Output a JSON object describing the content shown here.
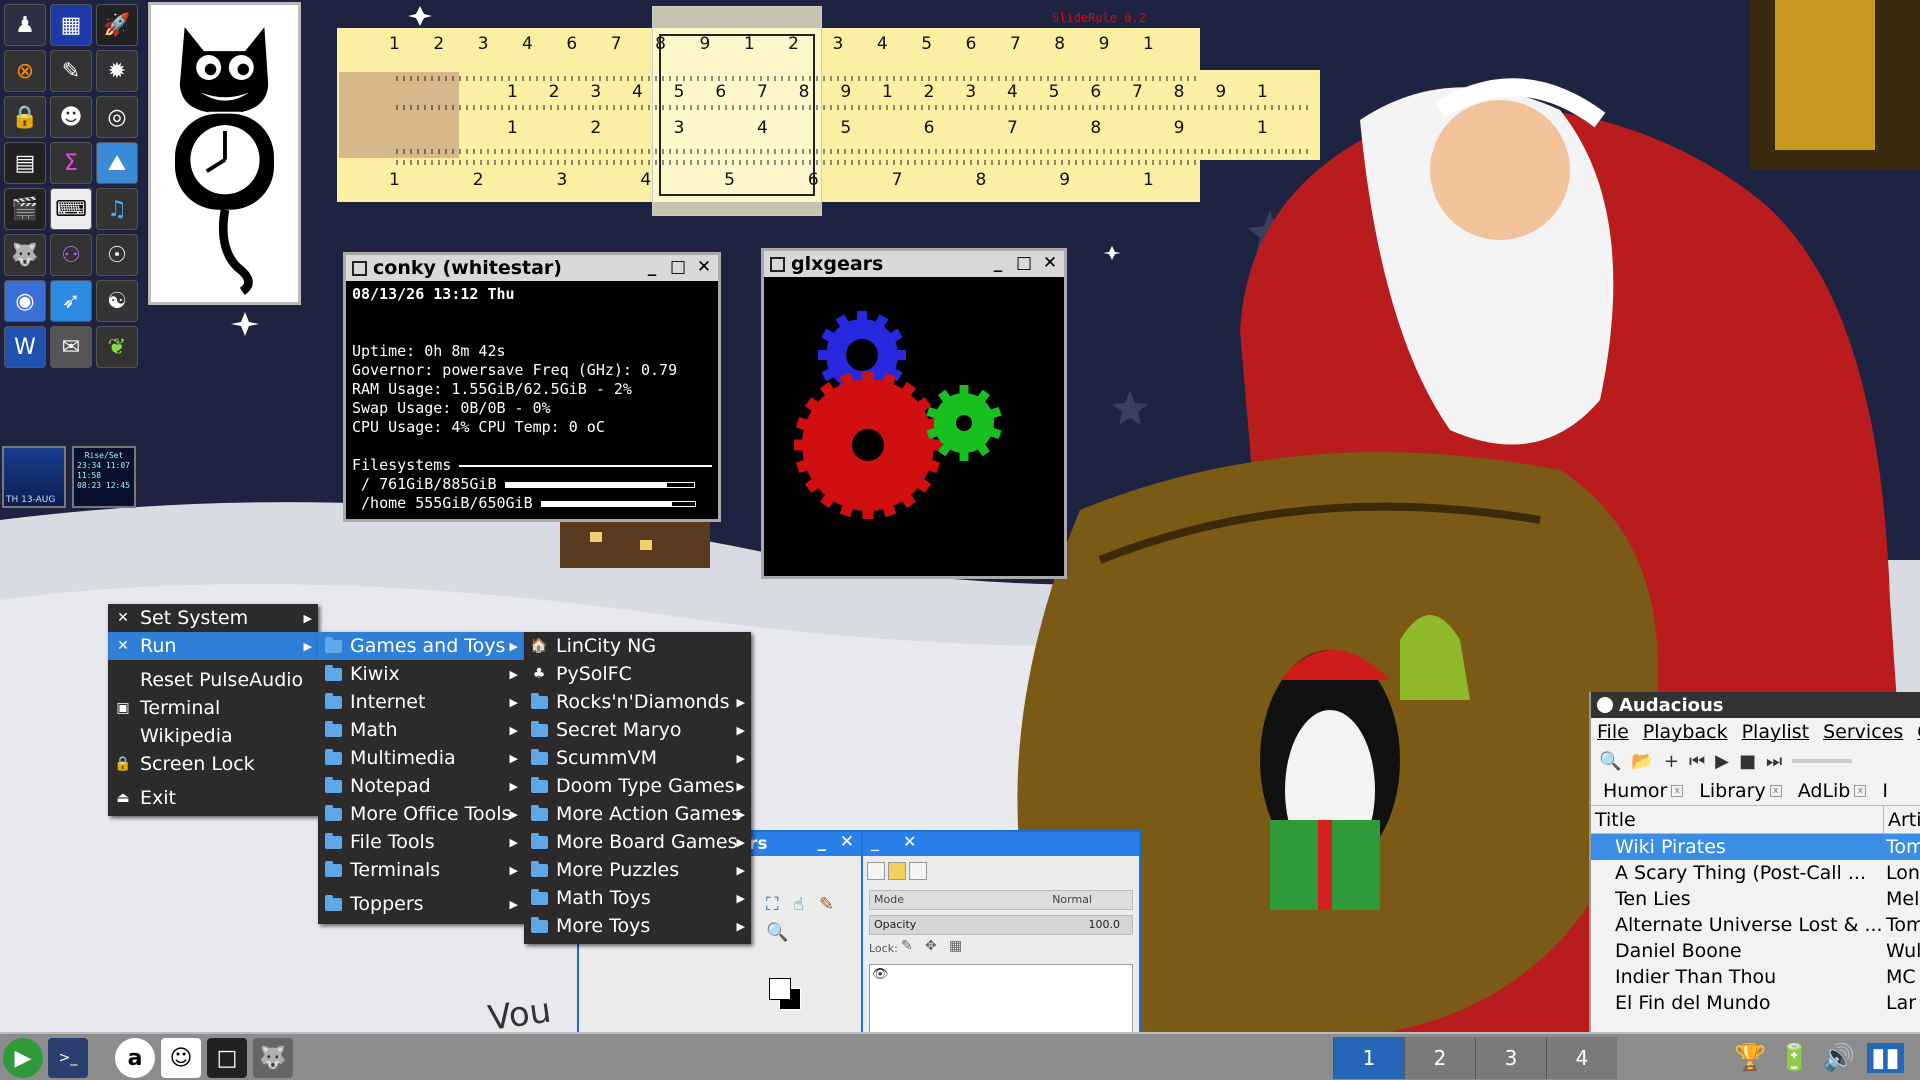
{
  "slide_rule": {
    "title": "SlideRule 0.2",
    "top_scale": [
      "1",
      "2",
      "3",
      "4",
      "6",
      "7",
      "8",
      "9",
      "1",
      "2",
      "3",
      "4",
      "5",
      "6",
      "7",
      "8",
      "9",
      "1"
    ],
    "slide_scale_1": [
      "1",
      "2",
      "3",
      "4",
      "5",
      "6",
      "7",
      "8",
      "9",
      "1",
      "2",
      "3",
      "4",
      "5",
      "6",
      "7",
      "8",
      "9",
      "1"
    ],
    "slide_scale_2": [
      "1",
      "2",
      "3",
      "4",
      "5",
      "6",
      "7",
      "8",
      "9",
      "1"
    ],
    "bottom_scale": [
      "1",
      "2",
      "3",
      "4",
      "5",
      "6",
      "7",
      "8",
      "9",
      "1"
    ]
  },
  "conky": {
    "title": "conky (whitestar)",
    "datetime": "08/13/26 13:12 Thu",
    "uptime": "Uptime: 0h 8m 42s",
    "governor": "Governor: powersave Freq (GHz): 0.79",
    "ram": "RAM Usage: 1.55GiB/62.5GiB - 2%",
    "swap": "Swap Usage: 0B/0B - 0%",
    "cpu": "CPU Usage: 4% CPU Temp: 0 oC",
    "fs_header": "Filesystems",
    "fs_root": " / 761GiB/885GiB",
    "fs_root_used": 0.86,
    "fs_home": " /home 555GiB/650GiB",
    "fs_home_used": 0.85
  },
  "glxgears": {
    "title": "glxgears"
  },
  "moon_widget": {
    "label": "TH 13-AUG"
  },
  "riseset_widget": {
    "title": "Rise/Set",
    "lines": [
      "23:34 11:07",
      "11:58",
      "08:23 12:45"
    ]
  },
  "gimp": {
    "toolbox_title_fragment": "rs",
    "mode_label": "Mode",
    "mode_value": "Normal",
    "opacity_label": "Opacity",
    "opacity_value": "100.0",
    "lock_label": "Lock:"
  },
  "menu_main": {
    "items": [
      {
        "label": "Set System",
        "icon": "tools-icon",
        "submenu": true
      },
      {
        "label": "Run",
        "icon": "tools-icon",
        "submenu": true,
        "selected": true
      },
      {
        "label": "Reset PulseAudio",
        "icon": ""
      },
      {
        "label": "Terminal",
        "icon": "terminal-icon"
      },
      {
        "label": "Wikipedia",
        "icon": ""
      },
      {
        "label": "Screen Lock",
        "icon": "lock-icon"
      },
      {
        "label": "Exit",
        "icon": "exit-icon"
      }
    ]
  },
  "menu_run": {
    "items": [
      {
        "label": "Games and Toys",
        "selected": true
      },
      {
        "label": "Kiwix"
      },
      {
        "label": "Internet"
      },
      {
        "label": "Math"
      },
      {
        "label": "Multimedia"
      },
      {
        "label": "Notepad"
      },
      {
        "label": "More Office Tools"
      },
      {
        "label": "File Tools"
      },
      {
        "label": "Terminals"
      },
      {
        "label": "Toppers"
      }
    ]
  },
  "menu_games": {
    "items": [
      {
        "label": "LinCity NG",
        "icon": "lincity-icon",
        "submenu": false
      },
      {
        "label": "PySolFC",
        "icon": "cards-icon",
        "submenu": false
      },
      {
        "label": "Rocks'n'Diamonds",
        "submenu": true
      },
      {
        "label": "Secret Maryo",
        "submenu": true
      },
      {
        "label": "ScummVM",
        "submenu": true
      },
      {
        "label": "Doom Type Games",
        "submenu": true
      },
      {
        "label": "More Action Games",
        "submenu": true
      },
      {
        "label": "More Board Games",
        "submenu": true
      },
      {
        "label": "More Puzzles",
        "submenu": true
      },
      {
        "label": "Math Toys",
        "submenu": true
      },
      {
        "label": "More Toys",
        "submenu": true
      }
    ]
  },
  "audacious": {
    "title": "Audacious",
    "menu": [
      "File",
      "Playback",
      "Playlist",
      "Services",
      "O"
    ],
    "tabs": [
      "Humor",
      "Library",
      "AdLib",
      "I"
    ],
    "columns": [
      "Title",
      "Arti"
    ],
    "rows": [
      {
        "title": "Wiki Pirates",
        "artist": "Tom",
        "selected": true
      },
      {
        "title": "A Scary Thing (Post-Call ...",
        "artist": "Lon"
      },
      {
        "title": "Ten Lies",
        "artist": "Mel"
      },
      {
        "title": "Alternate Universe Lost & ...",
        "artist": "Tom"
      },
      {
        "title": "Daniel Boone",
        "artist": "Wul"
      },
      {
        "title": "Indier Than Thou",
        "artist": "MC"
      },
      {
        "title": "El Fin del Mundo",
        "artist": "Lar"
      }
    ]
  },
  "taskbar": {
    "pager": [
      "1",
      "2",
      "3",
      "4"
    ],
    "active_desktop": "1"
  }
}
